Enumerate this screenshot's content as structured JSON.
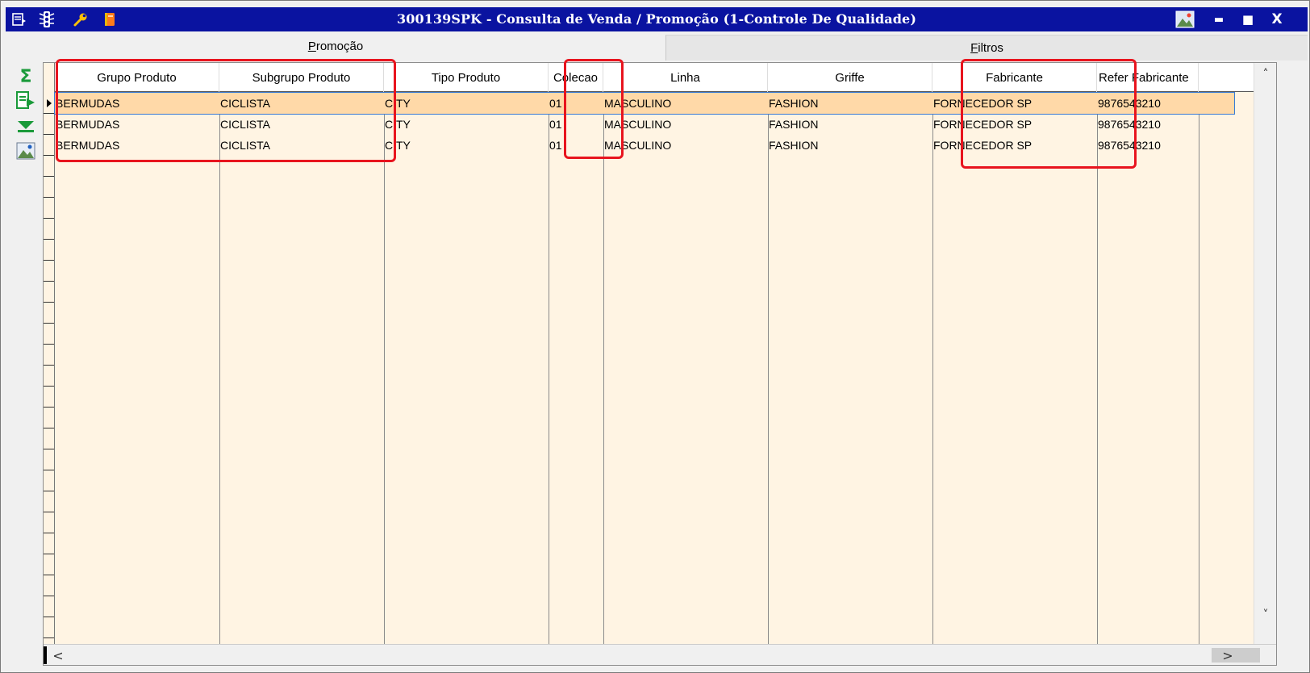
{
  "window": {
    "title": "300139SPK - Consulta de Venda / Promoção (1-Controle De Qualidade)",
    "titlebar_bg": "#0a13a0",
    "icons": [
      "menu-icon",
      "traffic-light-icon",
      "wrench-icon",
      "book-icon"
    ],
    "controls": [
      "picture-icon",
      "minimize-icon",
      "maximize-icon",
      "close-icon"
    ],
    "minimize_glyph": "▬",
    "maximize_glyph": "■",
    "close_glyph": "X"
  },
  "tabs": [
    {
      "label_pre": "",
      "label_ul": "P",
      "label_post": "romoção",
      "active": true
    },
    {
      "label_pre": "",
      "label_ul": "F",
      "label_post": "iltros",
      "active": false
    }
  ],
  "toolbar": {
    "items": [
      "sum-icon",
      "export-icon",
      "filter-down-icon",
      "image-icon"
    ],
    "sum_glyph": "Σ"
  },
  "grid": {
    "columns": [
      "Grupo Produto",
      "Subgrupo Produto",
      "Tipo Produto",
      "Colecao",
      "Linha",
      "Griffe",
      "Fabricante",
      "Refer Fabricante"
    ],
    "rows": [
      [
        "BERMUDAS",
        "CICLISTA",
        "CITY",
        "01",
        "MASCULINO",
        "FASHION",
        "FORNECEDOR SP",
        "9876543210"
      ],
      [
        "BERMUDAS",
        "CICLISTA",
        "CITY",
        "01",
        "MASCULINO",
        "FASHION",
        "FORNECEDOR SP",
        "9876543210"
      ],
      [
        "BERMUDAS",
        "CICLISTA",
        "CITY",
        "01",
        "MASCULINO",
        "FASHION",
        "FORNECEDOR SP",
        "9876543210"
      ]
    ],
    "selected_row": 0,
    "row_bg": "#fff4e3",
    "selected_bg": "#ffd9a8"
  },
  "scroll": {
    "up_glyph": "˄",
    "down_glyph": "˅",
    "left_glyph": "<",
    "right_glyph": ">"
  },
  "highlight_color": "#e8141e"
}
